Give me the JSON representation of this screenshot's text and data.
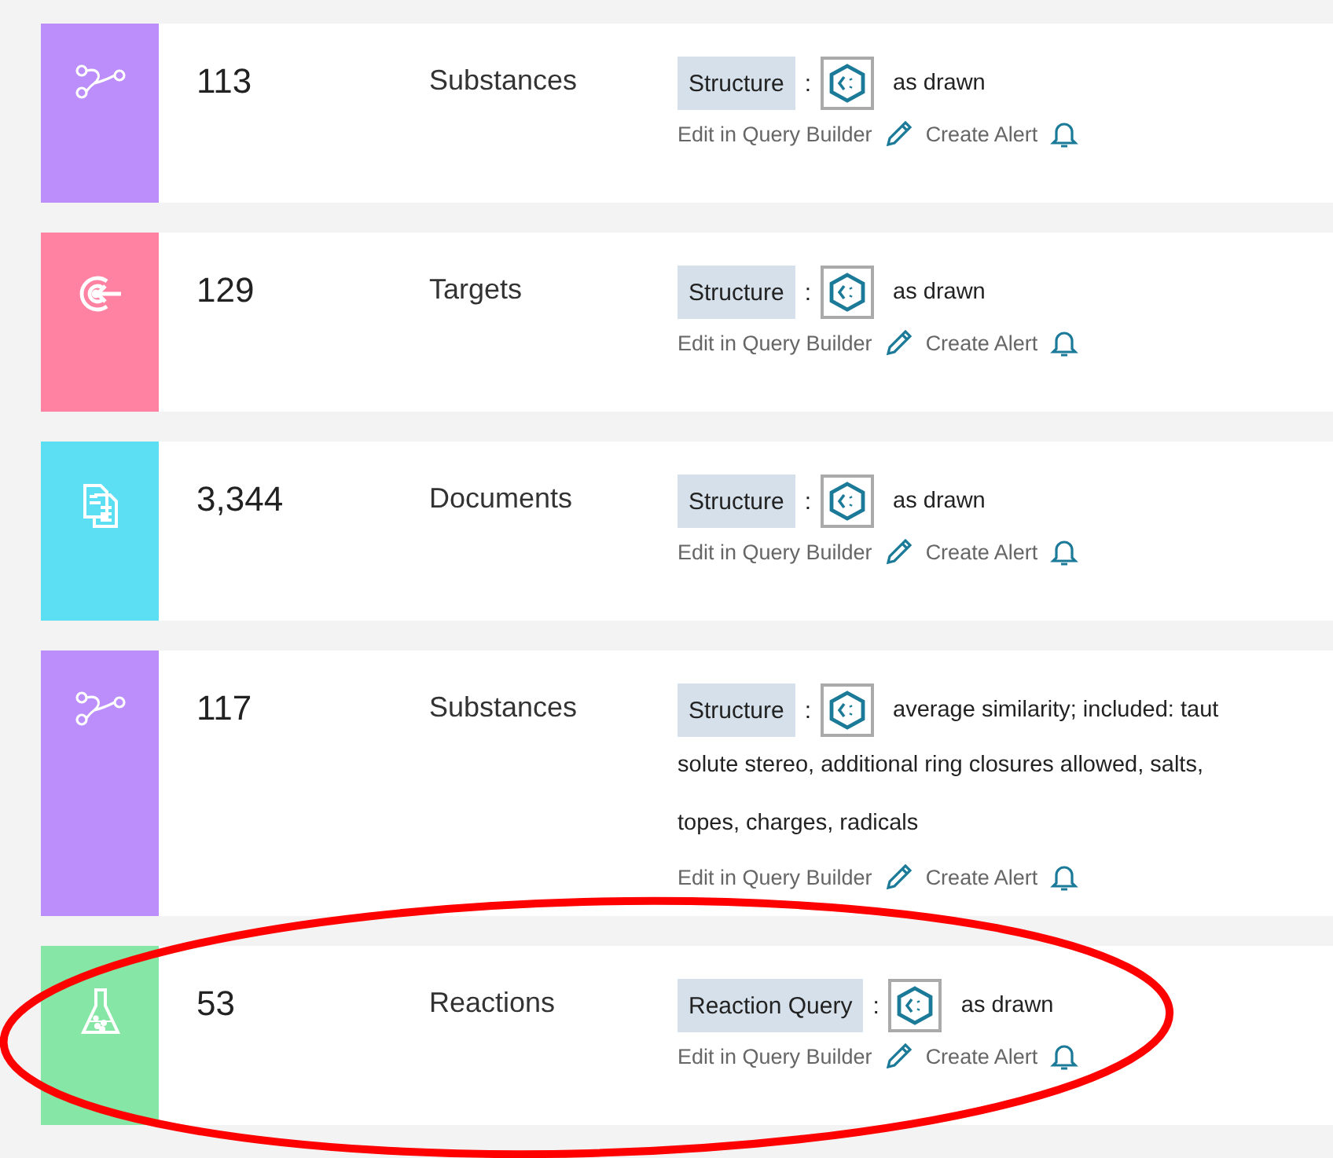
{
  "results": [
    {
      "kind": "substances",
      "color": "#bb8efc",
      "count": "113",
      "type": "Substances",
      "query_label": "Structure",
      "separator": ":",
      "description": [
        "as drawn"
      ],
      "edit_link": "Edit in Query Builder",
      "alert_link": "Create Alert"
    },
    {
      "kind": "targets",
      "color": "#ff82a3",
      "count": "129",
      "type": "Targets",
      "query_label": "Structure",
      "separator": ":",
      "description": [
        "as drawn"
      ],
      "edit_link": "Edit in Query Builder",
      "alert_link": "Create Alert"
    },
    {
      "kind": "documents",
      "color": "#5ddff3",
      "count": "3,344",
      "type": "Documents",
      "query_label": "Structure",
      "separator": ":",
      "description": [
        "as drawn"
      ],
      "edit_link": "Edit in Query Builder",
      "alert_link": "Create Alert"
    },
    {
      "kind": "substances",
      "color": "#bb8efc",
      "count": "117",
      "type": "Substances",
      "query_label": "Structure",
      "separator": ":",
      "description": [
        "average similarity; included: taut",
        "solute stereo, additional ring closures allowed, salts,",
        "topes, charges, radicals"
      ],
      "edit_link": "Edit in Query Builder",
      "alert_link": "Create Alert"
    },
    {
      "kind": "reactions",
      "color": "#86e6a5",
      "count": "53",
      "type": "Reactions",
      "query_label": "Reaction Query",
      "separator": ":",
      "description": [
        "as drawn"
      ],
      "edit_link": "Edit in Query Builder",
      "alert_link": "Create Alert"
    }
  ],
  "annotation": {
    "kind": "ellipse"
  }
}
